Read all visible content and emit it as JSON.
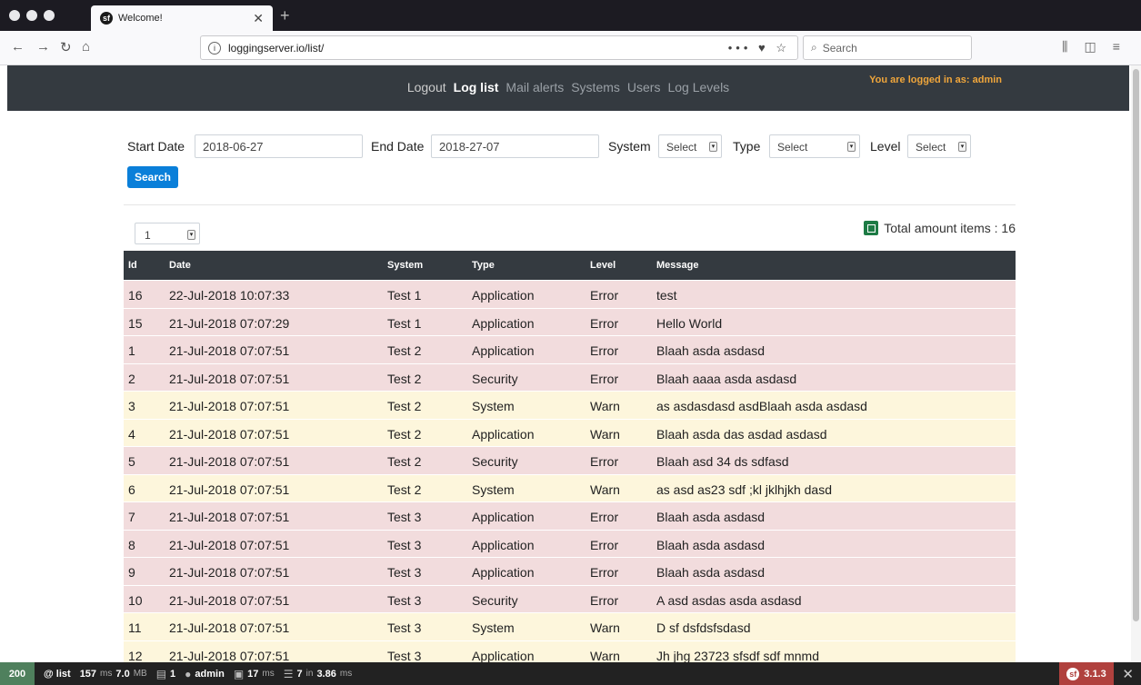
{
  "browser": {
    "tab_title": "Welcome!",
    "tab_favicon": "symfony-icon",
    "url": "loggingserver.io/list/",
    "search_placeholder": "Search",
    "page_actions": "••• ♥ ☆"
  },
  "header": {
    "nav": [
      "Logout",
      "Log list",
      "Mail alerts",
      "Systems",
      "Users",
      "Log Levels"
    ],
    "active": "Log list",
    "login_info": "You are logged in as: admin"
  },
  "filters": {
    "start_label": "Start Date",
    "start_value": "2018-06-27",
    "end_label": "End Date",
    "end_value": "2018-27-07",
    "system_label": "System",
    "system_value": "Select",
    "type_label": "Type",
    "type_value": "Select",
    "level_label": "Level",
    "level_value": "Select",
    "search_button": "Search"
  },
  "pagination": {
    "page": "1"
  },
  "total": "Total amount items : 16",
  "table": {
    "columns": [
      "Id",
      "Date",
      "System",
      "Type",
      "Level",
      "Message"
    ],
    "rows": [
      [
        "16",
        "22-Jul-2018 10:07:33",
        "Test 1",
        "Application",
        "Error",
        "test"
      ],
      [
        "15",
        "21-Jul-2018 07:07:29",
        "Test 1",
        "Application",
        "Error",
        "Hello World"
      ],
      [
        "1",
        "21-Jul-2018 07:07:51",
        "Test 2",
        "Application",
        "Error",
        "Blaah asda asdasd"
      ],
      [
        "2",
        "21-Jul-2018 07:07:51",
        "Test 2",
        "Security",
        "Error",
        "Blaah aaaa asda asdasd"
      ],
      [
        "3",
        "21-Jul-2018 07:07:51",
        "Test 2",
        "System",
        "Warn",
        "as asdasdasd asdBlaah asda asdasd"
      ],
      [
        "4",
        "21-Jul-2018 07:07:51",
        "Test 2",
        "Application",
        "Warn",
        "Blaah asda das asdad asdasd"
      ],
      [
        "5",
        "21-Jul-2018 07:07:51",
        "Test 2",
        "Security",
        "Error",
        "Blaah asd 34 ds sdfasd"
      ],
      [
        "6",
        "21-Jul-2018 07:07:51",
        "Test 2",
        "System",
        "Warn",
        "as asd as23 sdf ;kl jklhjkh dasd"
      ],
      [
        "7",
        "21-Jul-2018 07:07:51",
        "Test 3",
        "Application",
        "Error",
        "Blaah asda asdasd"
      ],
      [
        "8",
        "21-Jul-2018 07:07:51",
        "Test 3",
        "Application",
        "Error",
        "Blaah asda asdasd"
      ],
      [
        "9",
        "21-Jul-2018 07:07:51",
        "Test 3",
        "Application",
        "Error",
        "Blaah asda asdasd"
      ],
      [
        "10",
        "21-Jul-2018 07:07:51",
        "Test 3",
        "Security",
        "Error",
        "A asd asdas asda asdasd"
      ],
      [
        "11",
        "21-Jul-2018 07:07:51",
        "Test 3",
        "System",
        "Warn",
        "D sf dsfdsfsdasd"
      ],
      [
        "12",
        "21-Jul-2018 07:07:51",
        "Test 3",
        "Application",
        "Warn",
        "Jh jhg 23723 sfsdf sdf mnmd"
      ]
    ]
  },
  "colors": {
    "error_row": "#f2dcdd",
    "warn_row": "#fdf6dc",
    "header_bg": "#343a40",
    "login_info": "#f0a63b",
    "search_button": "#0a7fd9"
  },
  "symfony": {
    "status": "200",
    "route": "@ list",
    "time_value": "157",
    "time_unit": "ms",
    "memory_value": "7.0",
    "memory_unit": "MB",
    "forms": "1",
    "user": "admin",
    "twig_value": "17",
    "twig_unit": "ms",
    "db_queries": "7",
    "db_in": "in",
    "db_time": "3.86",
    "db_unit": "ms",
    "version": "3.1.3"
  }
}
